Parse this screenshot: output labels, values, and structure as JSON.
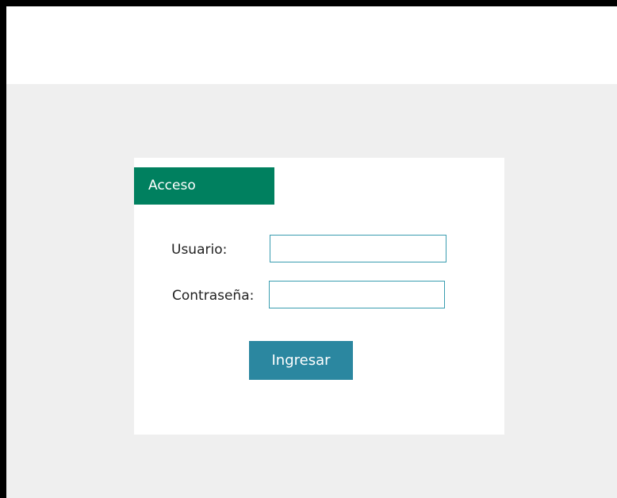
{
  "login": {
    "header_title": "Acceso",
    "username_label": "Usuario:",
    "username_value": "",
    "password_label": "Contraseña:",
    "password_value": "",
    "submit_label": "Ingresar"
  },
  "colors": {
    "header_bg": "#00805f",
    "button_bg": "#2b87a0",
    "input_border": "#3a9db0",
    "page_bg": "#efefef"
  }
}
